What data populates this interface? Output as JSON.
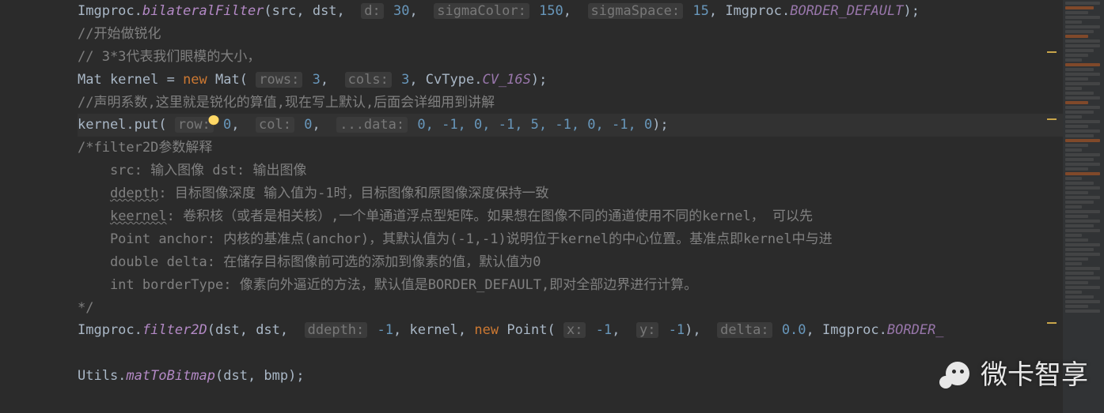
{
  "watermark": "微卡智享",
  "lines": {
    "l1": {
      "pre": "Imgproc.",
      "method": "bilateralFilter",
      "open": "(src, dst, ",
      "h1": "d:",
      "v1": "30",
      "c1": ", ",
      "h2": "sigmaColor:",
      "v2": "150",
      "c2": ", ",
      "h3": "sigmaSpace:",
      "v3": "15",
      "c3": ", Imgproc.",
      "tail": "BORDER_DEFAULT",
      "end": ");"
    },
    "l2": "//开始做锐化",
    "l3": "// 3*3代表我们眼模的大小，",
    "l4": {
      "a": "Mat kernel = ",
      "kw": "new",
      "b": " Mat(",
      "h1": "rows:",
      "v1": "3",
      "c1": ", ",
      "h2": "cols:",
      "v2": "3",
      "c2": ", CvType.",
      "stat": "CV_16S",
      "end": ");"
    },
    "l5": "//声明系数,这里就是锐化的算值,现在写上默认,后面会详细用到讲解",
    "l6": {
      "a": "kernel.put(",
      "h1": "row:",
      "v1": "0",
      "c1": ", ",
      "h2": "col:",
      "v2": "0",
      "c2": ", ",
      "h3": "...data:",
      "v3": "0",
      "rest": ", -1, 0, -1, 5, -1, 0, -1, 0",
      "end": ");"
    },
    "l7": "/*filter2D参数解释",
    "l8": "    src: 输入图像 dst: 输出图像",
    "l9": "    ddepth: 目标图像深度 输入值为-1时，目标图像和原图像深度保持一致",
    "l10": "    keernel: 卷积核（或者是相关核）,一个单通道浮点型矩阵。如果想在图像不同的通道使用不同的kernel， 可以先",
    "l11": "    Point anchor: 内核的基准点(anchor)，其默认值为(-1,-1)说明位于kernel的中心位置。基准点即kernel中与进",
    "l12": "    double delta: 在储存目标图像前可选的添加到像素的值，默认值为0",
    "l13": "    int borderType: 像素向外逼近的方法，默认值是BORDER_DEFAULT,即对全部边界进行计算。",
    "l14": "*/",
    "l15": {
      "a": "Imgproc.",
      "m": "filter2D",
      "b": "(dst, dst, ",
      "h1": "ddepth:",
      "v1": "-1",
      "c1": ", kernel, ",
      "kw": "new",
      "c2": " Point(",
      "h2": "x:",
      "v2": "-1",
      "c3": ", ",
      "h3": "y:",
      "v3": "-1",
      "c4": "), ",
      "h4": "delta:",
      "v4": "0.0",
      "c5": ", Imgproc.",
      "tail": "BORDER_",
      "end": ""
    },
    "l16": {
      "a": "Utils.",
      "m": "matToBitmap",
      "b": "(dst, bmp);"
    }
  }
}
